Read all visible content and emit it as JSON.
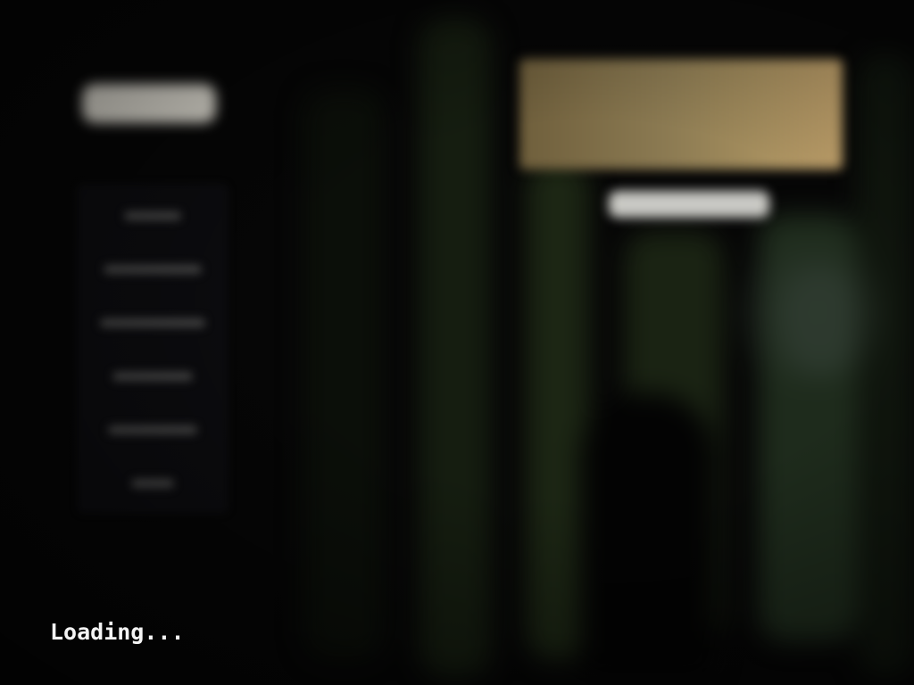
{
  "loading": {
    "text": "Loading..."
  },
  "menu": {
    "items": [
      {
        "label": ""
      },
      {
        "label": ""
      },
      {
        "label": ""
      },
      {
        "label": ""
      },
      {
        "label": ""
      },
      {
        "label": ""
      }
    ]
  },
  "colors": {
    "background": "#060606",
    "sign": "#a18b5c",
    "loading_text": "#f4f4f4"
  },
  "title_sign": {
    "text": ""
  }
}
